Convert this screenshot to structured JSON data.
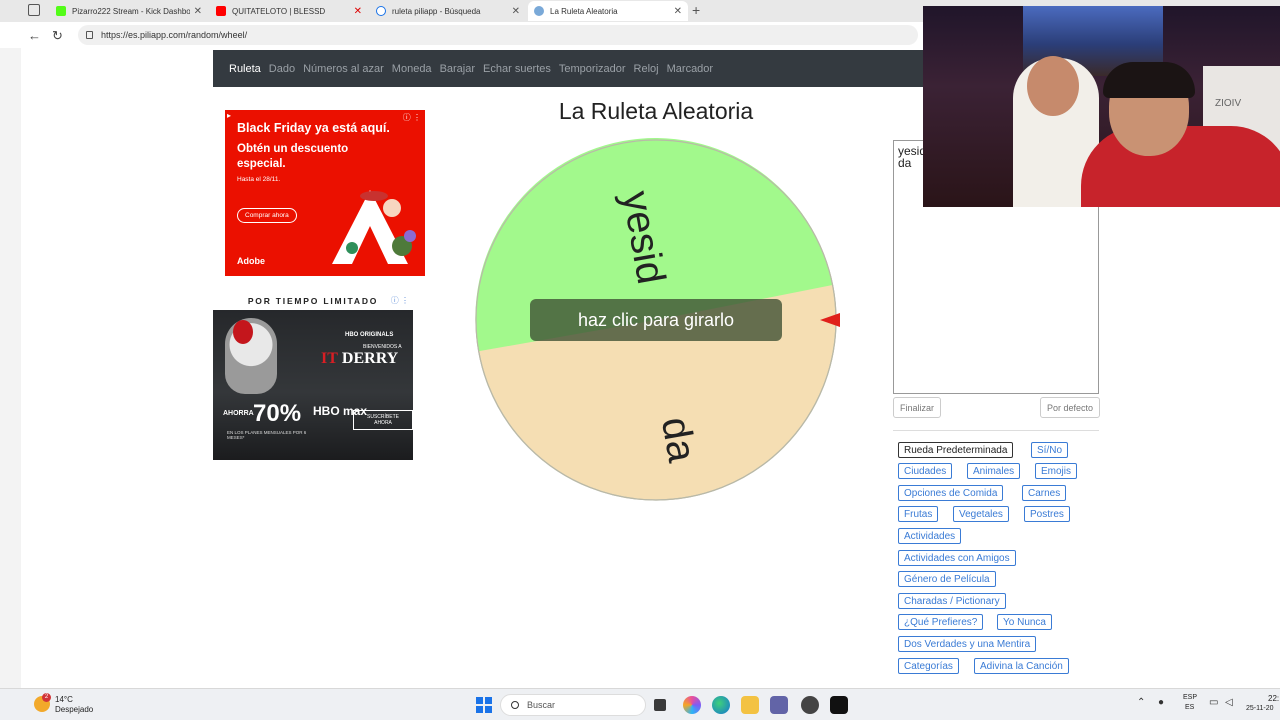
{
  "browser": {
    "tabs": [
      {
        "title": "Pizarro222 Stream - Kick Dashboa",
        "favicon_color": "#53fc18"
      },
      {
        "title": "QUITATELOTO | BLESSD",
        "favicon_color": "#ff0000"
      },
      {
        "title": "ruleta piliapp - Búsqueda",
        "favicon_color": "#1a73e8"
      },
      {
        "title": "La Ruleta Aleatoria",
        "favicon_color": "#7aa9d8"
      }
    ],
    "new_tab": "+",
    "url": "https://es.piliapp.com/random/wheel/"
  },
  "nav": {
    "links": [
      "Ruleta",
      "Dado",
      "Números al azar",
      "Moneda",
      "Barajar",
      "Echar suertes",
      "Temporizador",
      "Reloj",
      "Marcador"
    ]
  },
  "ads": {
    "adobe": {
      "headline": "Black Friday ya está aquí.",
      "subhead": "Obtén un descuento especial.",
      "small": "Hasta el 28/11.",
      "button": "Comprar ahora",
      "brand": "Adobe"
    },
    "hbo": {
      "label": "POR TIEMPO LIMITADO",
      "hbo_tag": "HBO ORIGINALS",
      "bienvenidos": "BIENVENIDOS A",
      "show": "DERRY",
      "ahora": "AHORRA",
      "percent": "70%",
      "brand": "HBO max",
      "cta": "SUSCRÍBETE AHORA",
      "planes": "EN LOS PLANES MENSUALES POR 6 MESES*"
    }
  },
  "main": {
    "title": "La Ruleta Aleatoria",
    "spin_label": "haz clic para girarlo",
    "wheel": {
      "segments": [
        {
          "label": "yesid",
          "color": "#a2f98c"
        },
        {
          "label": "da",
          "color": "#f5deb3"
        }
      ],
      "pointer_color": "#e0201b"
    }
  },
  "editor": {
    "text": "yesid\nda",
    "finalize": "Finalizar",
    "default": "Por defecto"
  },
  "presets": [
    "Rueda Predeterminada",
    "Sí/No",
    "Ciudades",
    "Animales",
    "Emojis",
    "Opciones de Comida",
    "Carnes",
    "Frutas",
    "Vegetales",
    "Postres",
    "Actividades",
    "Actividades con Amigos",
    "Género de Película",
    "Charadas / Pictionary",
    "¿Qué Prefieres?",
    "Yo Nunca",
    "Dos Verdades y una Mentira",
    "Categorías",
    "Adivina la Canción"
  ],
  "webcam": {
    "wall_text": "ZIOIV"
  },
  "taskbar": {
    "weather_badge": "2",
    "temperature": "14°C",
    "weather": "Despejado",
    "search": "Buscar",
    "lang1": "ESP",
    "lang2": "ES",
    "time": "22:",
    "date": "25-11-20"
  }
}
